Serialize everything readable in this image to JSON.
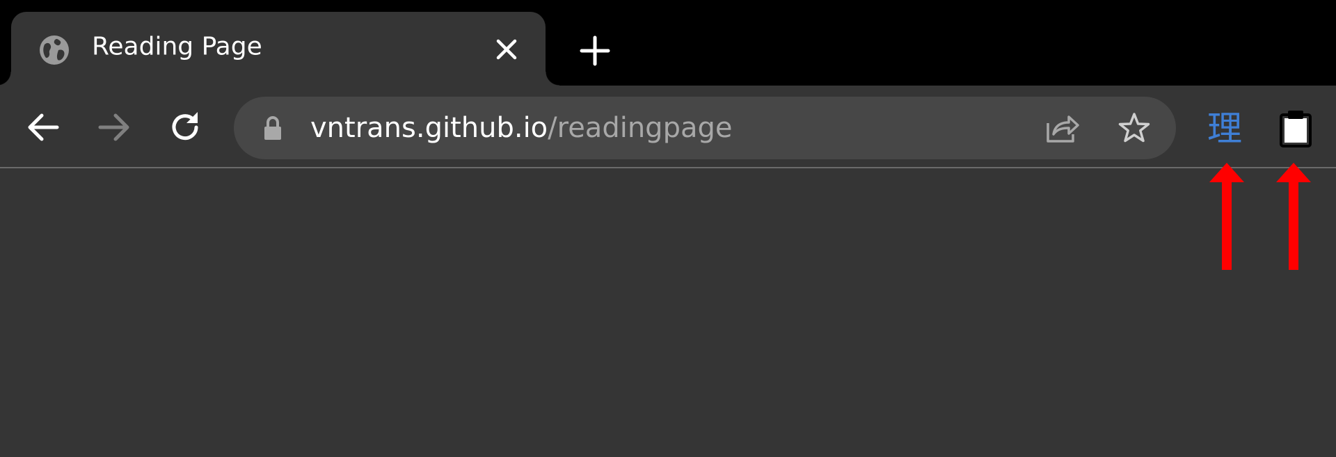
{
  "tabs": [
    {
      "title": "Reading Page",
      "favicon": "globe-icon",
      "close_icon": "close-icon"
    }
  ],
  "new_tab_icon": "plus-icon",
  "toolbar": {
    "back_icon": "back-arrow-icon",
    "forward_icon": "forward-arrow-icon",
    "reload_icon": "reload-icon"
  },
  "omnibox": {
    "security_icon": "lock-icon",
    "url_host": "vntrans.github.io",
    "url_path": "/readingpage",
    "share_icon": "share-icon",
    "bookmark_icon": "star-icon"
  },
  "extensions": {
    "translate_label": "理",
    "translate_color": "#3f7fd6",
    "clipboard_icon": "clipboard-icon"
  },
  "annotations": {
    "arrow_color": "#ff0000",
    "arrow_icon": "up-arrow-icon"
  },
  "colors": {
    "tabstrip_bg": "#000000",
    "toolbar_bg": "#353535",
    "omnibox_bg": "#474747",
    "text_primary": "#ffffff",
    "text_secondary": "#a8a8a8"
  }
}
